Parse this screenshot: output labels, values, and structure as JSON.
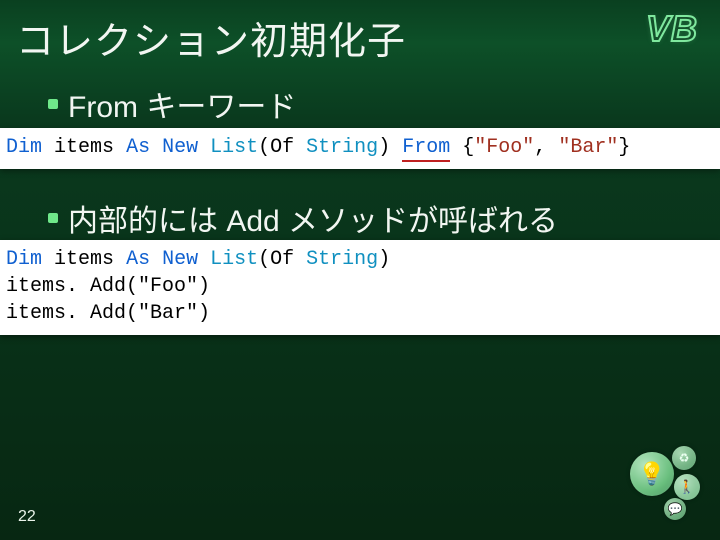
{
  "title": "コレクション初期化子",
  "badge": "VB",
  "bullets": {
    "b1": "From キーワード",
    "b2": "内部的には Add メソッドが呼ばれる"
  },
  "code1": {
    "dim": "Dim",
    "items": "items",
    "as": "As",
    "new_": "New",
    "list": "List",
    "of_open": "(Of",
    "string_t": "String",
    "close_paren": ")",
    "from_kw": "From",
    "brace_open": "{",
    "foo": "\"Foo\"",
    "comma": ",",
    "bar": "\"Bar\"",
    "brace_close": "}"
  },
  "code2": {
    "line1": {
      "dim": "Dim",
      "items": "items",
      "as": "As",
      "new_": "New",
      "list": "List",
      "of_open": "(Of",
      "string_t": "String",
      "close_paren": ")"
    },
    "line2": "items. Add(\"Foo\")",
    "line3": "items. Add(\"Bar\")"
  },
  "page_number": "22",
  "icons": {
    "bulb": "💡",
    "recycle": "♻",
    "chat": "💬",
    "walk": "🚶"
  }
}
